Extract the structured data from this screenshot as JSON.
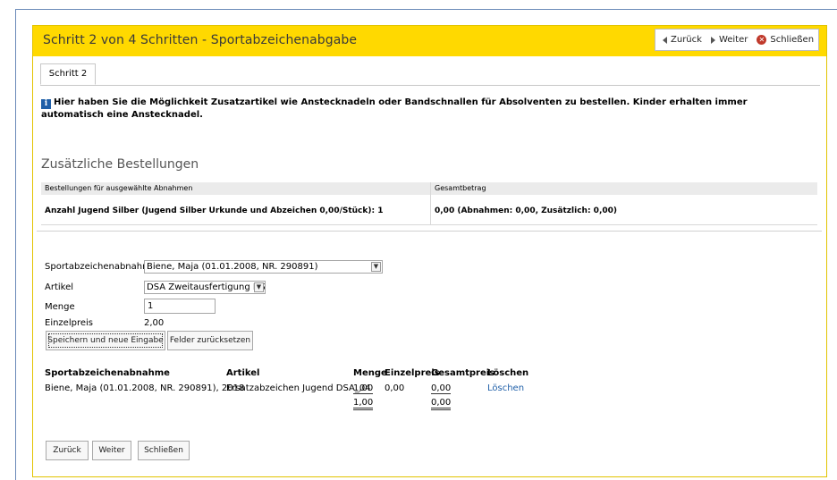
{
  "window": {
    "title": "Schritt 2 von 4 Schritten - Sportabzeichenabgabe",
    "nav": {
      "back": "Zurück",
      "next": "Weiter",
      "close": "Schließen"
    },
    "tab": "Schritt 2"
  },
  "info_text": "Hier haben Sie die Möglichkeit Zusatzartikel wie Anstecknadeln oder Bandschnallen für Absolventen zu bestellen. Kinder erhalten immer automatisch eine Anstecknadel.",
  "orders": {
    "title": "Zusätzliche Bestellungen",
    "col1_header": "Bestellungen für ausgewählte Abnahmen",
    "col2_header": "Gesamtbetrag",
    "row_left": "Anzahl Jugend Silber (Jugend Silber Urkunde und Abzeichen 0,00/Stück): 1",
    "row_right": "0,00 (Abnahmen: 0,00, Zusätzlich: 0,00)"
  },
  "form": {
    "abnahme_label": "Sportabzeichenabnahme",
    "abnahme_value": "Biene, Maja (01.01.2008, NR. 290891)",
    "artikel_label": "Artikel",
    "artikel_value": "DSA Zweitausfertigung DSA",
    "menge_label": "Menge",
    "menge_value": "1",
    "einzelpreis_label": "Einzelpreis",
    "einzelpreis_value": "2,00",
    "save_button": "Speichern und neue Eingabe",
    "reset_button": "Felder zurücksetzen"
  },
  "table": {
    "headers": [
      "Sportabzeichenabnahme",
      "Artikel",
      "Menge",
      "Einzelpreis",
      "Gesamtpreis",
      "Löschen"
    ],
    "row": {
      "abnahme": "Biene, Maja (01.01.2008, NR. 290891), 2018",
      "artikel": "Ersatzabzeichen Jugend DSA_04",
      "menge": "1,00",
      "einzelpreis": "0,00",
      "gesamtpreis": "0,00",
      "loeschen": "Löschen"
    },
    "totals": {
      "menge": "1,00",
      "gesamtpreis": "0,00"
    }
  },
  "footer": {
    "back": "Zurück",
    "next": "Weiter",
    "close": "Schließen"
  }
}
